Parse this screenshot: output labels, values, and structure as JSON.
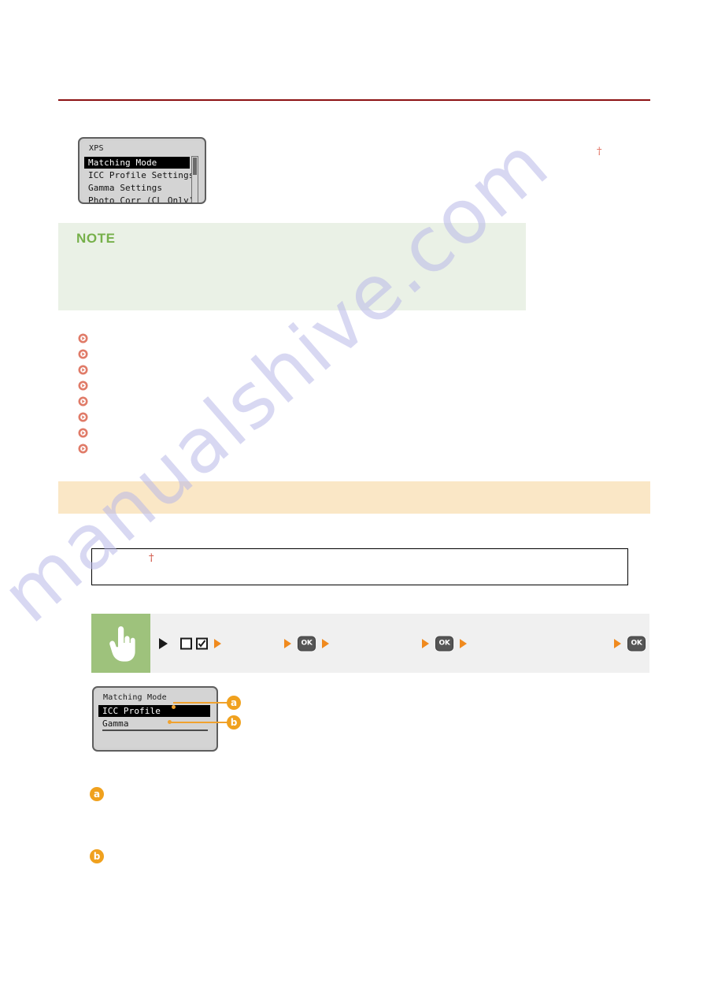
{
  "watermark": {
    "text": "manualshive.com"
  },
  "screens": {
    "xps": {
      "name": "xps-menu-screen",
      "title": "XPS",
      "rows": [
        {
          "label": "Matching Mode",
          "selected": true
        },
        {
          "label": "ICC Profile Settings",
          "selected": false
        },
        {
          "label": "Gamma Settings",
          "selected": false
        },
        {
          "label": "Photo Corr (CL Only)",
          "selected": false
        }
      ]
    },
    "matching": {
      "name": "matching-mode-screen",
      "title": "Matching Mode",
      "rows": [
        {
          "label": "ICC Profile",
          "selected": true
        },
        {
          "label": "Gamma",
          "selected": false
        }
      ]
    }
  },
  "dagger": {
    "symbol": "†"
  },
  "note": {
    "heading": "NOTE",
    "body": ""
  },
  "links": [
    {
      "label": ""
    },
    {
      "label": ""
    },
    {
      "label": ""
    },
    {
      "label": ""
    },
    {
      "label": ""
    },
    {
      "label": ""
    },
    {
      "label": ""
    },
    {
      "label": ""
    }
  ],
  "section_banner": {
    "title": ""
  },
  "spec_box": {
    "dagger": "†",
    "text": ""
  },
  "procedure": {
    "hand_icon": "pointing-hand-icon",
    "steps": [
      {
        "type": "triangle-black"
      },
      {
        "type": "icon-box-empty",
        "name": "menu-icon"
      },
      {
        "type": "icon-box-check",
        "name": "settings-check-icon"
      },
      {
        "type": "triangle-orange"
      },
      {
        "type": "label",
        "text": ""
      },
      {
        "type": "triangle-orange"
      },
      {
        "type": "ok-key",
        "label": "OK"
      },
      {
        "type": "triangle-orange"
      },
      {
        "type": "label",
        "text": ""
      },
      {
        "type": "triangle-orange"
      },
      {
        "type": "ok-key",
        "label": "OK"
      },
      {
        "type": "triangle-orange"
      },
      {
        "type": "label",
        "text": ""
      },
      {
        "type": "triangle-orange"
      },
      {
        "type": "ok-key",
        "label": "OK"
      }
    ]
  },
  "callouts": [
    {
      "id": "a",
      "badge": "a",
      "target": "ICC Profile",
      "description": ""
    },
    {
      "id": "b",
      "badge": "b",
      "target": "Gamma",
      "description": ""
    }
  ],
  "colors": {
    "rule": "#8c1113",
    "note_bg": "#eaf1e6",
    "note_heading": "#76b04a",
    "banner_bg": "#fae7c6",
    "badge": "#f0a11e",
    "hand_bg": "#9ec27c",
    "callout_line": "#f0a22e",
    "lcd_bg": "#d2d2d2",
    "watermark": "#b9b9e8"
  }
}
